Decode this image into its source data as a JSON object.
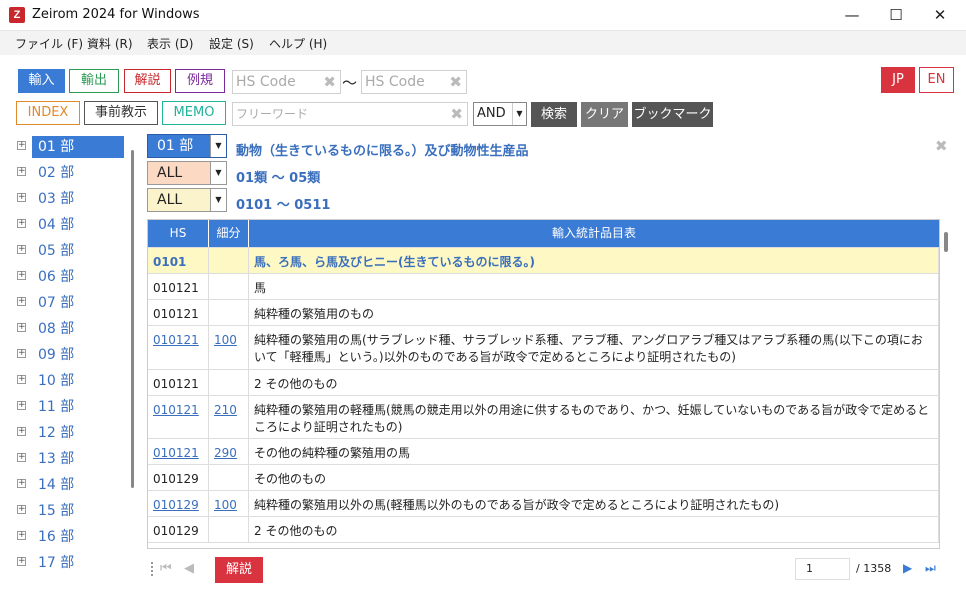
{
  "window": {
    "title": "Zeirom 2024 for Windows",
    "app_icon_letter": "Z",
    "minimize": "—",
    "maximize": "☐",
    "close": "✕"
  },
  "menu": [
    {
      "label": "ファイル (F)"
    },
    {
      "label": "資料 (R)"
    },
    {
      "label": "表示 (D)"
    },
    {
      "label": "設定 (S)"
    },
    {
      "label": "ヘルプ (H)"
    }
  ],
  "toolbar": {
    "import": "輸入",
    "export": "輸出",
    "explain": "解説",
    "rules": "例規",
    "index": "INDEX",
    "prior_ruling": "事前教示",
    "memo": "MEMO",
    "hs_from_placeholder": "HS Code",
    "tilde": "〜",
    "hs_to_placeholder": "HS Code",
    "freeword_placeholder": "フリーワード",
    "logic": "AND",
    "search": "検索",
    "clear": "クリア",
    "bookmark": "ブックマーク",
    "lang_jp": "JP",
    "lang_en": "EN"
  },
  "tree": [
    {
      "label": "01 部",
      "selected": true
    },
    {
      "label": "02 部"
    },
    {
      "label": "03 部"
    },
    {
      "label": "04 部"
    },
    {
      "label": "05 部"
    },
    {
      "label": "06 部"
    },
    {
      "label": "07 部"
    },
    {
      "label": "08 部"
    },
    {
      "label": "09 部"
    },
    {
      "label": "10 部"
    },
    {
      "label": "11 部"
    },
    {
      "label": "12 部"
    },
    {
      "label": "13 部"
    },
    {
      "label": "14 部"
    },
    {
      "label": "15 部"
    },
    {
      "label": "16 部"
    },
    {
      "label": "17 部"
    }
  ],
  "filters": {
    "section_value": "01 部",
    "section_desc": "動物（生きているものに限る。）及び動物性生産品",
    "chapter_value": "ALL",
    "chapter_desc": "01類 ～ 05類",
    "heading_value": "ALL",
    "heading_desc": "0101 ～ 0511"
  },
  "table": {
    "headers": {
      "hs": "HS",
      "sub": "細分",
      "desc": "輸入統計品目表"
    },
    "rows": [
      {
        "hs": "0101",
        "sub": "",
        "desc": "馬、ろ馬、ら馬及びヒニー(生きているものに限る。)",
        "highlight": true,
        "link": false
      },
      {
        "hs": "010121",
        "sub": "",
        "desc": "馬",
        "link": false
      },
      {
        "hs": "010121",
        "sub": "",
        "desc": "純粋種の繁殖用のもの",
        "link": false
      },
      {
        "hs": "010121",
        "sub": "100",
        "desc": "純粋種の繁殖用の馬(サラブレッド種、サラブレッド系種、アラブ種、アングロアラブ種又はアラブ系種の馬(以下この項において「軽種馬」という。)以外のものである旨が政令で定めるところにより証明されたもの)",
        "link": true
      },
      {
        "hs": "010121",
        "sub": "",
        "desc": "2 その他のもの",
        "link": false
      },
      {
        "hs": "010121",
        "sub": "210",
        "desc": "純粋種の繁殖用の軽種馬(競馬の競走用以外の用途に供するものであり、かつ、妊娠していないものである旨が政令で定めるところにより証明されたもの)",
        "link": true
      },
      {
        "hs": "010121",
        "sub": "290",
        "desc": "その他の純粋種の繁殖用の馬",
        "link": true
      },
      {
        "hs": "010129",
        "sub": "",
        "desc": "その他のもの",
        "link": false
      },
      {
        "hs": "010129",
        "sub": "100",
        "desc": "純粋種の繁殖用以外の馬(軽種馬以外のものである旨が政令で定めるところにより証明されたもの)",
        "link": true
      },
      {
        "hs": "010129",
        "sub": "",
        "desc": "2 その他のもの",
        "link": false
      }
    ]
  },
  "footer": {
    "explain": "解説",
    "page_current": "1",
    "page_total": "/ 1358",
    "first_icon": "⏮",
    "prev_icon": "◀",
    "next_icon": "▶",
    "last_icon": "⏭"
  }
}
